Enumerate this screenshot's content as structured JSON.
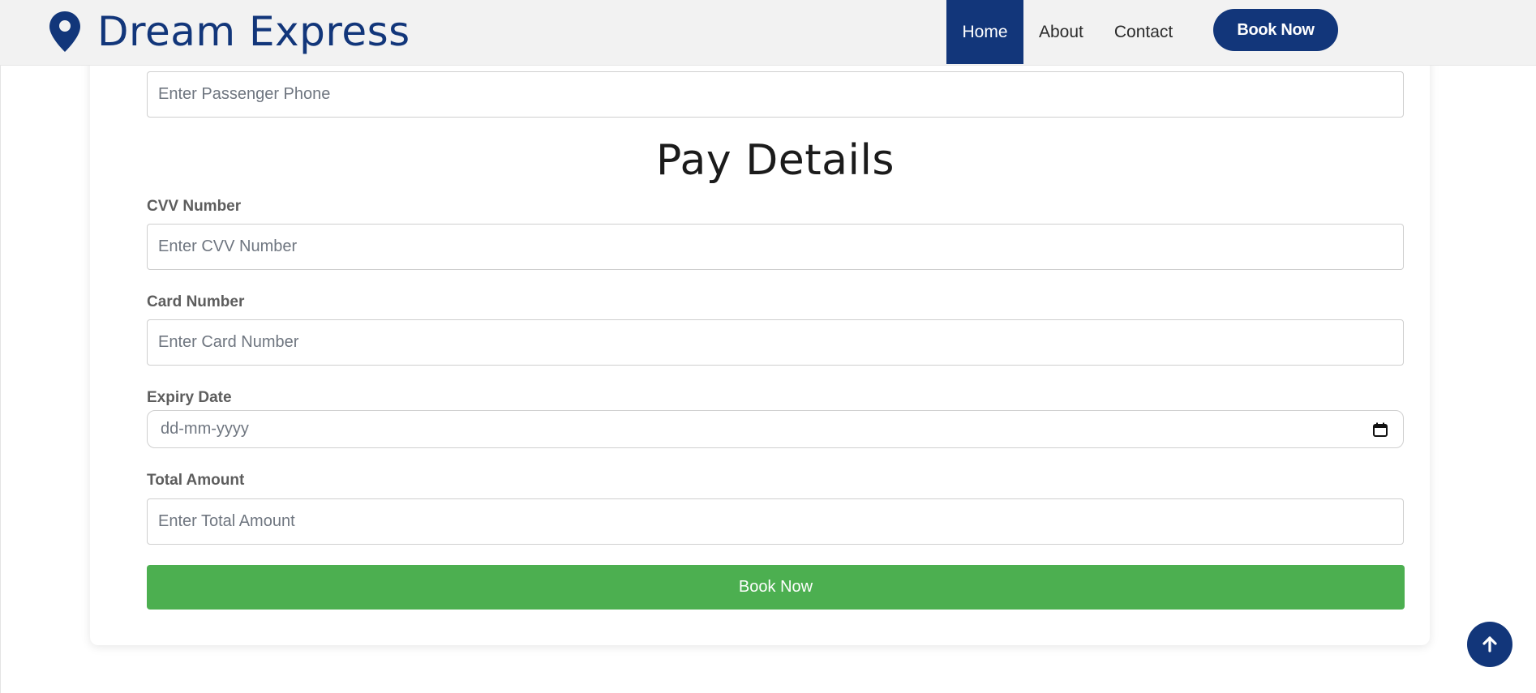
{
  "header": {
    "brand_name": "Dream Express",
    "nav": {
      "home": "Home",
      "about": "About",
      "contact": "Contact"
    },
    "book_now_label": "Book Now"
  },
  "form": {
    "passenger_phone": {
      "placeholder": "Enter Passenger Phone",
      "value": ""
    },
    "pay_details_title": "Pay Details",
    "cvv": {
      "label": "CVV Number",
      "placeholder": "Enter CVV Number",
      "value": ""
    },
    "card_number": {
      "label": "Card Number",
      "placeholder": "Enter Card Number",
      "value": ""
    },
    "expiry_date": {
      "label": "Expiry Date",
      "placeholder": "dd-mm-yyyy"
    },
    "total_amount": {
      "label": "Total Amount",
      "placeholder": "Enter Total Amount",
      "value": ""
    },
    "submit_label": "Book Now"
  },
  "icons": {
    "brand": "map-pin-icon",
    "date": "calendar-icon",
    "back_to_top": "arrow-up-icon"
  },
  "colors": {
    "brand_blue": "#12367a",
    "submit_green": "#4caf50",
    "header_bg": "#f2f2f2"
  }
}
